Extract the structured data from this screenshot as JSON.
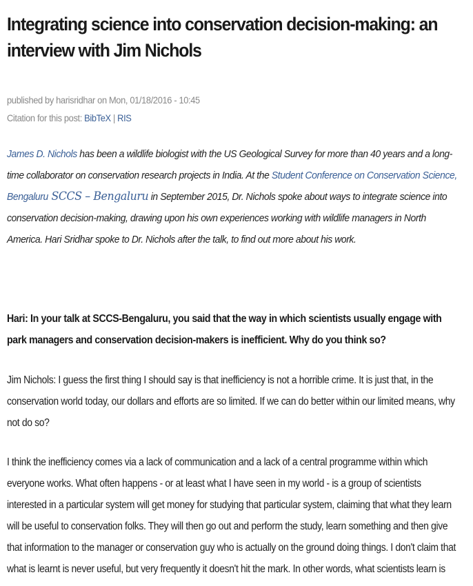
{
  "article": {
    "title": "Integrating science into conservation decision-making: an interview with Jim Nichols",
    "published": {
      "prefix": "published by ",
      "author": "harisridhar",
      "on_text": " on Mon, 01/18/2016 - 10:45"
    },
    "citation": {
      "label": "Citation for this post: ",
      "bibtex": "BibTeX",
      "separator": " | ",
      "ris": "RIS"
    },
    "intro": {
      "link_nichols": "James D. Nichols",
      "text1": " has been a wildlife biologist with the US Geological Survey for more than 40 years and a long-time collaborator on conservation research projects in India. At the ",
      "link_conference": "Student Conference on Conservation Science, Bengaluru",
      "link_sccs": " SCCS – Bengaluru",
      "text2": " in September 2015, Dr. Nichols spoke about ways to integrate science into conservation decision-making, drawing upon his own experiences working with wildlife managers in North America.  Hari Sridhar spoke to Dr. Nichols after the talk, to find out more about his work."
    },
    "question": "Hari: In your talk at SCCS-Bengaluru, you said that the way in which scientists usually engage with park managers and conservation decision-makers is inefficient. Why do you think so?",
    "answers": [
      "Jim Nichols: I guess the first thing I should say is that inefficiency is not a horrible crime. It is just that, in the conservation world today, our dollars and efforts are so limited. If we can do better within our limited means, why not do so?",
      "I think the inefficiency comes via a lack of communication and a lack of a central programme within which everyone works. What often happens - or at least what I have seen in my world - is a group of scientists interested in a particular system will get money for studying that particular system, claiming that what they learn will be useful to conservation folks. They will then go out and perform the study, learn something and then give that information to the manager or conservation guy who is actually on the ground doing things. I don't claim that what is learnt is never useful, but very frequently it doesn't hit the mark. In other words, what scientists learn is"
    ]
  },
  "colors": {
    "link": "#3a5f96",
    "meta_gray": "#888888",
    "text": "#222222"
  }
}
